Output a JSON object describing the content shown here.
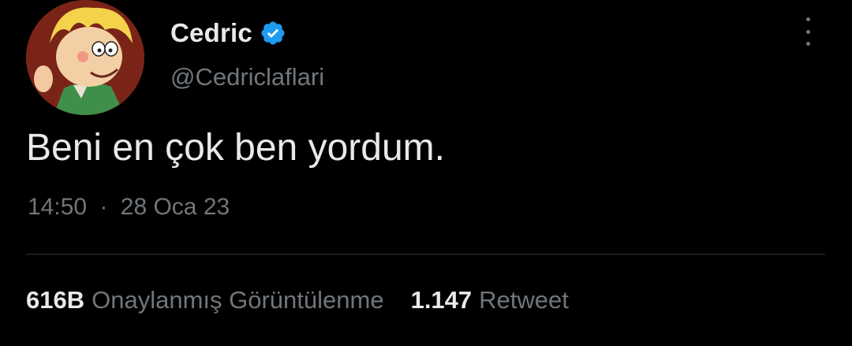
{
  "author": {
    "display_name": "Cedric",
    "handle": "@Cedriclaflari",
    "verified": true,
    "avatar_icon": "cartoon-boy-avatar"
  },
  "tweet": {
    "text": "Beni en çok ben yordum.",
    "time": "14:50",
    "separator": "·",
    "date": "28 Oca 23"
  },
  "stats": {
    "views_count": "616B",
    "views_label": "Onaylanmış Görüntülenme",
    "retweets_count": "1.147",
    "retweets_label": "Retweet"
  },
  "colors": {
    "background": "#000000",
    "primary_text": "#e7e9ea",
    "secondary_text": "#71767b",
    "verified_blue": "#1d9bf0",
    "divider": "#2f3336"
  }
}
